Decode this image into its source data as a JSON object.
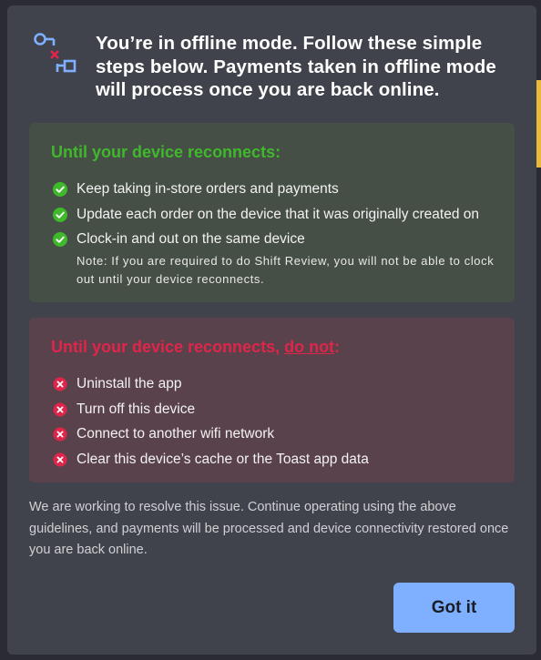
{
  "dialog": {
    "header": "You’re in offline mode. Follow these simple steps below. Payments taken in offline mode will process once you are back online.",
    "header_icon": "offline-connection-icon",
    "do_panel": {
      "title": "Until your device reconnects:",
      "bullet_icon": "check-circle-icon",
      "items": [
        "Keep taking in-store orders and payments",
        "Update each order on the device that it was originally created on",
        "Clock-in and out on the same device"
      ],
      "note": "Note: If you are required to do Shift Review, you will not be able to clock out until your device reconnects."
    },
    "dont_panel": {
      "title_prefix": "Until your device reconnects, ",
      "title_emphasis": "do not",
      "title_suffix": ":",
      "bullet_icon": "x-circle-icon",
      "items": [
        "Uninstall the app",
        "Turn off this device",
        "Connect to another wifi network",
        "Clear this device’s cache or the Toast app data"
      ]
    },
    "footer": "We are working to resolve this issue. Continue operating using the above guidelines, and payments will be processed and device connectivity restored once you are back online.",
    "button_label": "Got it"
  },
  "colors": {
    "dialog_bg": "#41434c",
    "do_panel_bg": "#464f46",
    "do_accent": "#3fb82b",
    "dont_panel_bg": "#5a424c",
    "dont_accent": "#e0254a",
    "button_bg": "#7fb0ff"
  }
}
